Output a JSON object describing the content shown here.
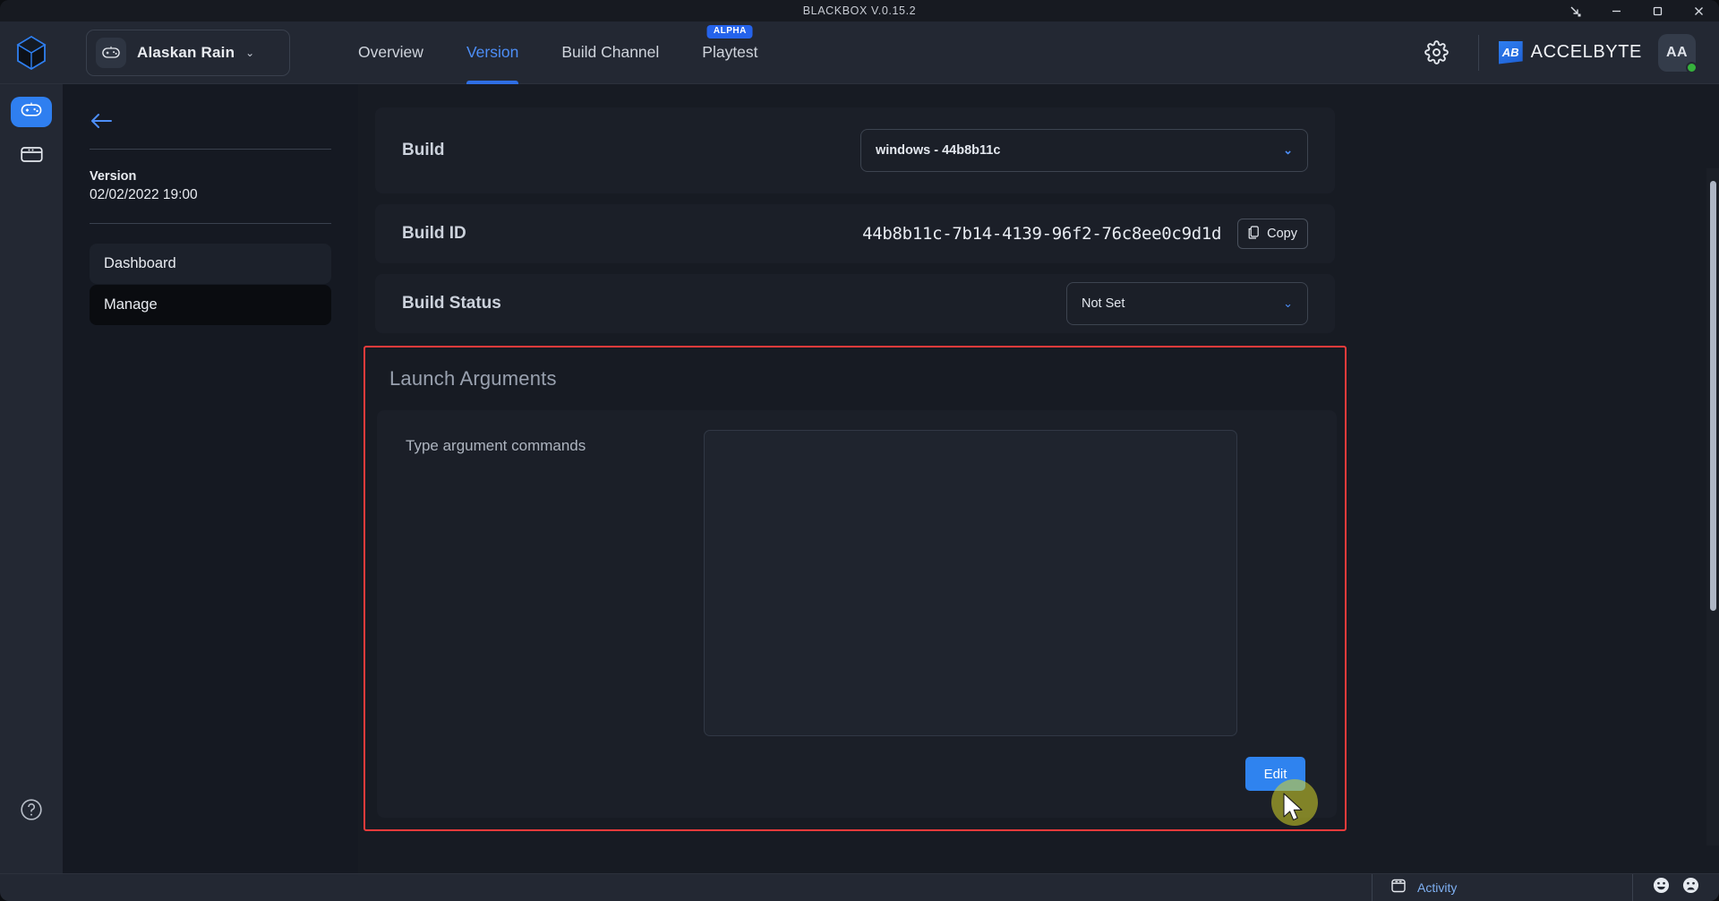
{
  "window": {
    "title": "BLACKBOX V.0.15.2",
    "controls": [
      {
        "name": "restore-down",
        "label": "Restore Down"
      },
      {
        "name": "minimize",
        "label": "Minimize"
      },
      {
        "name": "maximize",
        "label": "Maximize"
      },
      {
        "name": "close",
        "label": "Close"
      }
    ]
  },
  "header": {
    "app_switcher": {
      "name": "Alaskan Rain",
      "icon": "gamepad-icon",
      "chevron": "⌄"
    },
    "nav": [
      {
        "label": "Overview",
        "active": false,
        "badge": ""
      },
      {
        "label": "Version",
        "active": true,
        "badge": ""
      },
      {
        "label": "Build Channel",
        "active": false,
        "badge": ""
      },
      {
        "label": "Playtest",
        "active": false,
        "badge": "ALPHA"
      }
    ],
    "settings_icon": "gear-icon",
    "brand": {
      "mark": "AB",
      "text": "ACCELBYTE"
    },
    "avatar": {
      "initials": "AA",
      "status": "online"
    }
  },
  "rail": {
    "logo": "cube-logo-icon",
    "items": [
      {
        "name": "games",
        "icon": "gamepad-icon",
        "active": true
      },
      {
        "name": "builds",
        "icon": "window-icon",
        "active": false
      }
    ],
    "help_icon": "help-circle-icon"
  },
  "sidebar": {
    "back_label": "←",
    "section_label": "Version",
    "section_value": "02/02/2022 19:00",
    "items": [
      {
        "label": "Dashboard",
        "active": false
      },
      {
        "label": "Manage",
        "active": true
      }
    ]
  },
  "main": {
    "build": {
      "label": "Build",
      "selected": "windows - 44b8b11c",
      "chevron": "⌄"
    },
    "build_id": {
      "label": "Build ID",
      "value": "44b8b11c-7b14-4139-96f2-76c8ee0c9d1d",
      "copy_label": "Copy"
    },
    "build_status": {
      "label": "Build Status",
      "selected": "Not Set",
      "chevron": "⌄"
    },
    "launch_arguments": {
      "title": "Launch Arguments",
      "field_label": "Type argument commands",
      "textarea_value": "",
      "textarea_placeholder": "",
      "edit_label": "Edit",
      "highlight_color": "#ee3b3b"
    }
  },
  "statusbar": {
    "activity_label": "Activity",
    "activity_icon": "panel-icon",
    "feedback": [
      {
        "name": "happy-face-icon"
      },
      {
        "name": "sad-face-icon"
      }
    ]
  },
  "colors": {
    "accent_blue": "#2f7ff0",
    "link_blue": "#4d8ef7",
    "highlight_red": "#ee3b3b",
    "status_green": "#36b23c",
    "badge_blue": "#2563eb"
  }
}
